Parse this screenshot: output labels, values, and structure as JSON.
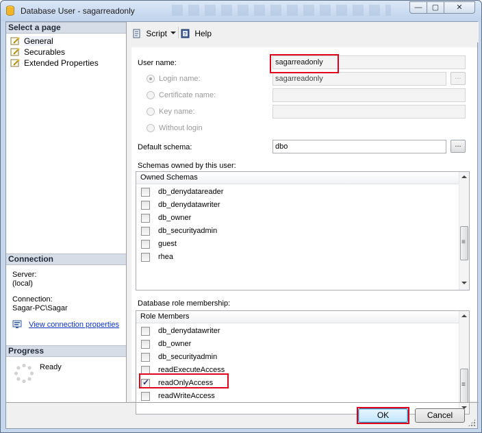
{
  "window": {
    "title": "Database User - sagarreadonly",
    "controls": {
      "minimize": "—",
      "maximize": "▢",
      "close": "✕"
    }
  },
  "left_pane": {
    "select_page_header": "Select a page",
    "pages": [
      {
        "label": "General",
        "icon": "page-wrench-icon",
        "selected": true
      },
      {
        "label": "Securables",
        "icon": "page-wrench-icon",
        "selected": false
      },
      {
        "label": "Extended Properties",
        "icon": "page-wrench-icon",
        "selected": false
      }
    ],
    "connection_header": "Connection",
    "server_label": "Server:",
    "server_value": "(local)",
    "connection_label": "Connection:",
    "connection_value": "Sagar-PC\\Sagar",
    "view_connection_link": "View connection properties",
    "progress_header": "Progress",
    "progress_status": "Ready"
  },
  "toolbar": {
    "script_label": "Script",
    "help_label": "Help"
  },
  "general": {
    "user_name_label": "User name:",
    "user_name_value": "sagarreadonly",
    "login_name_label": "Login name:",
    "login_name_value": "sagarreadonly",
    "certificate_name_label": "Certificate name:",
    "key_name_label": "Key name:",
    "without_login_label": "Without login",
    "default_schema_label": "Default schema:",
    "default_schema_value": "dbo",
    "ellipsis": "..."
  },
  "schemas_owned": {
    "label": "Schemas owned by this user:",
    "column_header": "Owned Schemas",
    "rows": [
      {
        "name": "db_denydatareader",
        "checked": false
      },
      {
        "name": "db_denydatawriter",
        "checked": false
      },
      {
        "name": "db_owner",
        "checked": false
      },
      {
        "name": "db_securityadmin",
        "checked": false
      },
      {
        "name": "guest",
        "checked": false
      },
      {
        "name": "rhea",
        "checked": false
      }
    ]
  },
  "role_membership": {
    "label": "Database role membership:",
    "column_header": "Role Members",
    "rows": [
      {
        "name": "db_denydatawriter",
        "checked": false
      },
      {
        "name": "db_owner",
        "checked": false
      },
      {
        "name": "db_securityadmin",
        "checked": false
      },
      {
        "name": "readExecuteAccess",
        "checked": false
      },
      {
        "name": "readOnlyAccess",
        "checked": true
      },
      {
        "name": "readWriteAccess",
        "checked": false
      }
    ]
  },
  "buttons": {
    "ok": "OK",
    "cancel": "Cancel"
  },
  "colors": {
    "highlight": "#e0001b",
    "link": "#0a33c8",
    "section_header": "#d7dde6"
  }
}
